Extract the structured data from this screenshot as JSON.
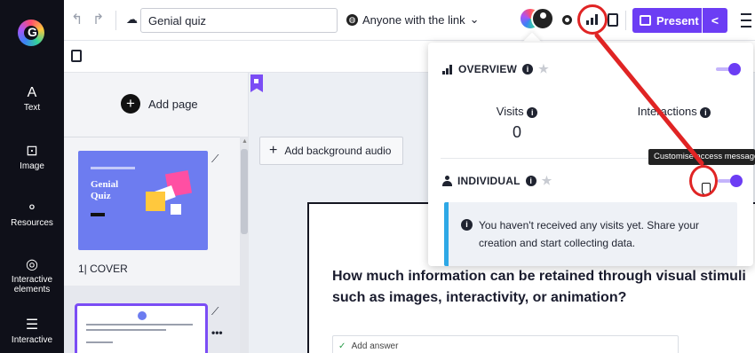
{
  "rail": {
    "logo_letter": "G",
    "items": [
      {
        "label": "Text",
        "icon": "text-icon"
      },
      {
        "label": "Image",
        "icon": "image-icon"
      },
      {
        "label": "Resources",
        "icon": "resources-icon"
      },
      {
        "label": "Interactive elements",
        "icon": "interactive-elements-icon"
      },
      {
        "label": "Interactive",
        "icon": "interactive-questions-icon"
      }
    ]
  },
  "topbar": {
    "title_value": "Genial quiz",
    "share_label": "Anyone with the link",
    "present_label": "Present"
  },
  "pages": {
    "add_page_label": "Add page",
    "thumb1_title_line1": "Genial",
    "thumb1_title_line2": "Quiz",
    "page1_label": "1| COVER"
  },
  "canvas": {
    "audio_label": "Add background audio",
    "question": "How much information can be retained through visual stimuli such as images, interactivity, or animation?",
    "answer_label": "Add answer"
  },
  "overview": {
    "section1_title": "OVERVIEW",
    "visits_label": "Visits",
    "visits_value": "0",
    "interactions_label": "Interactions",
    "section2_title": "INDIVIDUAL",
    "empty_message": "You haven't received any visits yet. Share your creation and start collecting data.",
    "tooltip": "Customise access message"
  },
  "colors": {
    "accent": "#6c3df4",
    "annotation_red": "#e02424",
    "info_border": "#2ea8e6"
  }
}
